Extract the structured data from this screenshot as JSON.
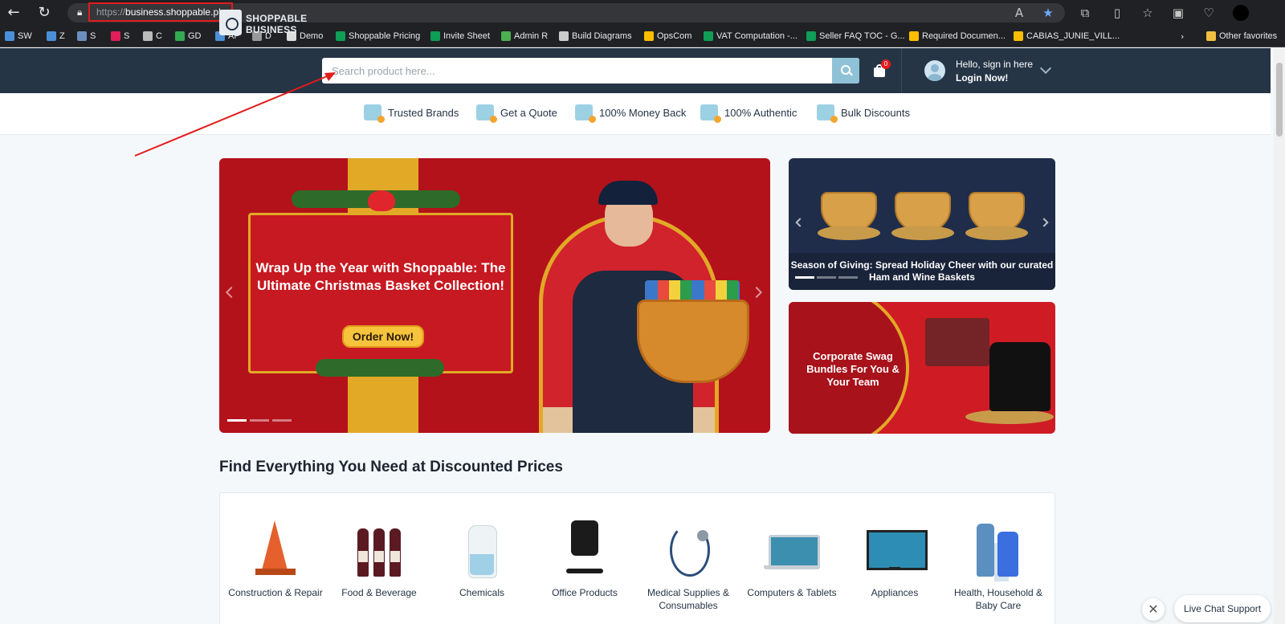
{
  "browser": {
    "url_scheme": "https://",
    "url_host": "business.shoppable.ph",
    "bookmarks": [
      "SW",
      "Z",
      "S",
      "S",
      "C",
      "GD",
      "AP",
      "D",
      "Demo",
      "Shoppable Pricing",
      "Invite Sheet",
      "Admin R",
      "Build Diagrams",
      "OpsCom",
      "VAT Computation -...",
      "Seller FAQ TOC - G...",
      "Required Documen...",
      "CABIAS_JUNIE_VILL..."
    ],
    "other_favorites": "Other favorites"
  },
  "header": {
    "logo_line1": "SHOPPABLE",
    "logo_line2": "BUSINESS",
    "search_placeholder": "Search product here...",
    "cart_count": "0",
    "greeting": "Hello, sign in here",
    "login": "Login Now!"
  },
  "value_props": [
    "Trusted Brands",
    "Get a Quote",
    "100% Money Back",
    "100% Authentic",
    "Bulk Discounts"
  ],
  "banners": {
    "main_headline": "Wrap Up the Year with Shoppable: The Ultimate Christmas Basket Collection!",
    "main_cta": "Order Now!",
    "right_top_caption": "Season of Giving: Spread Holiday Cheer with our curated Ham and Wine Baskets",
    "right_bottom_text": "Corporate Swag Bundles For You & Your Team"
  },
  "categories": {
    "title": "Find Everything You Need at Discounted Prices",
    "items": [
      "Construction & Repair",
      "Food & Beverage",
      "Chemicals",
      "Office Products",
      "Medical Supplies & Consumables",
      "Computers & Tablets",
      "Appliances",
      "Health, Household & Baby Care"
    ]
  },
  "chat": {
    "label": "Live Chat Support",
    "close": "✕"
  },
  "colors": {
    "header_bg": "#253546",
    "accent": "#8fc2d6",
    "annotation": "#e31b1b"
  }
}
